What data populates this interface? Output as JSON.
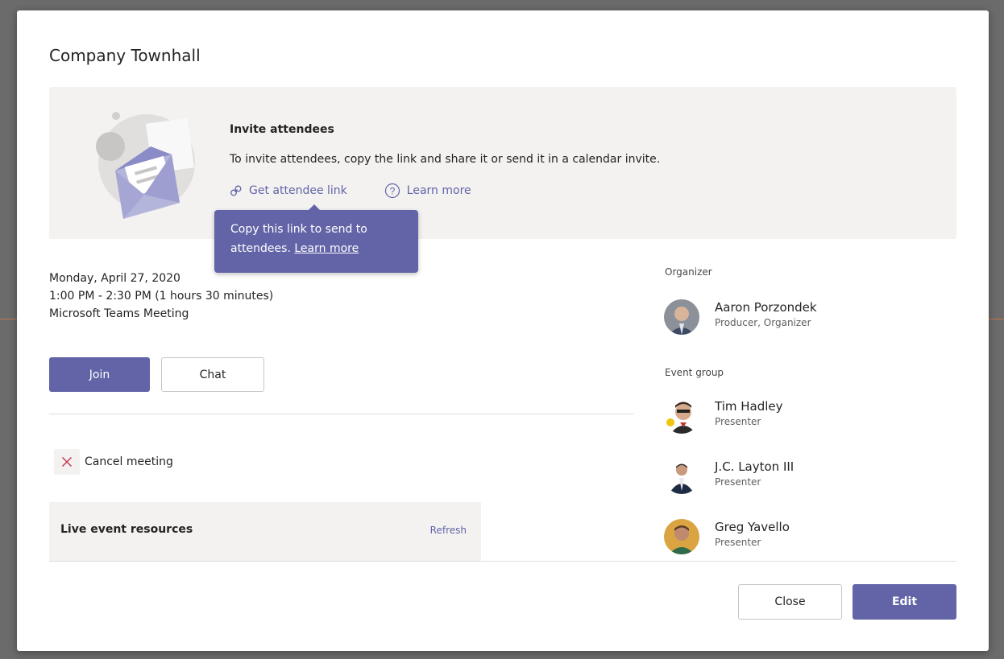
{
  "dialog": {
    "title": "Company Townhall"
  },
  "invite": {
    "title": "Invite attendees",
    "description": "To invite attendees, copy the link and share it or send it in a calendar invite.",
    "get_link_label": "Get attendee link",
    "learn_more_label": "Learn more"
  },
  "tooltip": {
    "text_line1": "Copy this link to send to",
    "text_line2": "attendees.",
    "link_label": "Learn more"
  },
  "meeting": {
    "date": "Monday, April 27, 2020",
    "time": "1:00 PM - 2:30 PM (1 hours 30 minutes)",
    "location": "Microsoft Teams Meeting"
  },
  "actions": {
    "join_label": "Join",
    "chat_label": "Chat",
    "cancel_label": "Cancel meeting"
  },
  "resources": {
    "title": "Live event resources",
    "refresh_label": "Refresh"
  },
  "organizer": {
    "section_label": "Organizer",
    "name": "Aaron Porzondek",
    "role": "Producer, Organizer"
  },
  "event_group": {
    "section_label": "Event group",
    "members": [
      {
        "name": "Tim Hadley",
        "role": "Presenter"
      },
      {
        "name": "J.C. Layton III",
        "role": "Presenter"
      },
      {
        "name": "Greg Yavello",
        "role": "Presenter"
      }
    ]
  },
  "footer": {
    "close_label": "Close",
    "edit_label": "Edit"
  },
  "colors": {
    "accent": "#6264a7",
    "banner_bg": "#f3f2f1",
    "cancel_icon": "#c4314b"
  }
}
